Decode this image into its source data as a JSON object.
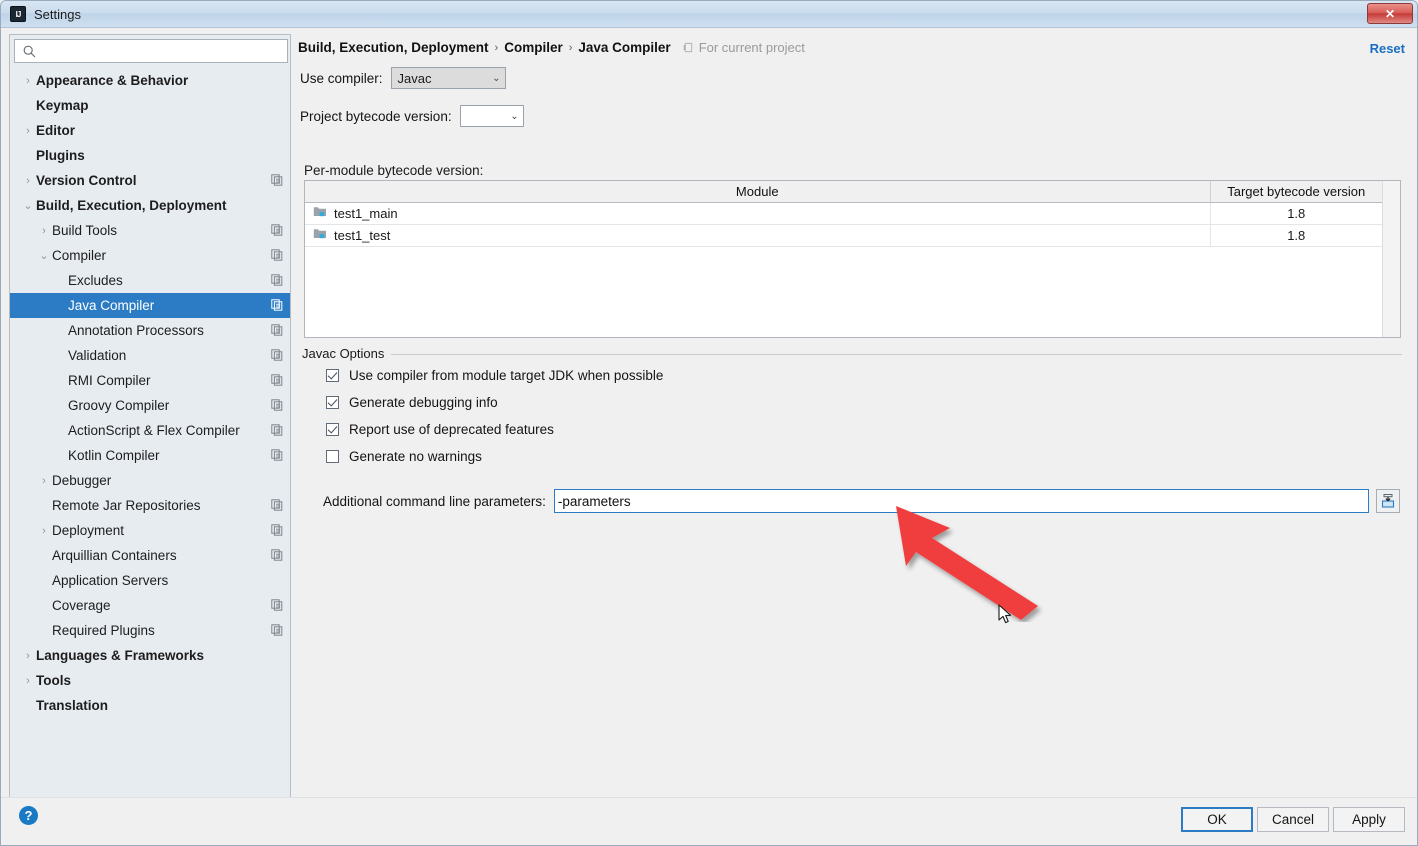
{
  "window": {
    "title": "Settings",
    "app_icon": "intellij-idea-icon",
    "close_label": "✕"
  },
  "sidebar": {
    "search": {
      "value": "",
      "placeholder": ""
    },
    "items": [
      {
        "label": "Appearance & Behavior",
        "indent": 0,
        "arrow": "right",
        "bold": true,
        "cfg": false,
        "selected": false
      },
      {
        "label": "Keymap",
        "indent": 0,
        "arrow": "none",
        "bold": true,
        "cfg": false,
        "selected": false
      },
      {
        "label": "Editor",
        "indent": 0,
        "arrow": "right",
        "bold": true,
        "cfg": false,
        "selected": false
      },
      {
        "label": "Plugins",
        "indent": 0,
        "arrow": "none",
        "bold": true,
        "cfg": false,
        "selected": false
      },
      {
        "label": "Version Control",
        "indent": 0,
        "arrow": "right",
        "bold": true,
        "cfg": true,
        "selected": false
      },
      {
        "label": "Build, Execution, Deployment",
        "indent": 0,
        "arrow": "down",
        "bold": true,
        "cfg": false,
        "selected": false
      },
      {
        "label": "Build Tools",
        "indent": 1,
        "arrow": "right",
        "bold": false,
        "cfg": true,
        "selected": false
      },
      {
        "label": "Compiler",
        "indent": 1,
        "arrow": "down",
        "bold": false,
        "cfg": true,
        "selected": false
      },
      {
        "label": "Excludes",
        "indent": 2,
        "arrow": "none",
        "bold": false,
        "cfg": true,
        "selected": false
      },
      {
        "label": "Java Compiler",
        "indent": 2,
        "arrow": "none",
        "bold": false,
        "cfg": true,
        "selected": true
      },
      {
        "label": "Annotation Processors",
        "indent": 2,
        "arrow": "none",
        "bold": false,
        "cfg": true,
        "selected": false
      },
      {
        "label": "Validation",
        "indent": 2,
        "arrow": "none",
        "bold": false,
        "cfg": true,
        "selected": false
      },
      {
        "label": "RMI Compiler",
        "indent": 2,
        "arrow": "none",
        "bold": false,
        "cfg": true,
        "selected": false
      },
      {
        "label": "Groovy Compiler",
        "indent": 2,
        "arrow": "none",
        "bold": false,
        "cfg": true,
        "selected": false
      },
      {
        "label": "ActionScript & Flex Compiler",
        "indent": 2,
        "arrow": "none",
        "bold": false,
        "cfg": true,
        "selected": false
      },
      {
        "label": "Kotlin Compiler",
        "indent": 2,
        "arrow": "none",
        "bold": false,
        "cfg": true,
        "selected": false
      },
      {
        "label": "Debugger",
        "indent": 1,
        "arrow": "right",
        "bold": false,
        "cfg": false,
        "selected": false
      },
      {
        "label": "Remote Jar Repositories",
        "indent": 1,
        "arrow": "none",
        "bold": false,
        "cfg": true,
        "selected": false
      },
      {
        "label": "Deployment",
        "indent": 1,
        "arrow": "right",
        "bold": false,
        "cfg": true,
        "selected": false
      },
      {
        "label": "Arquillian Containers",
        "indent": 1,
        "arrow": "none",
        "bold": false,
        "cfg": true,
        "selected": false
      },
      {
        "label": "Application Servers",
        "indent": 1,
        "arrow": "none",
        "bold": false,
        "cfg": false,
        "selected": false
      },
      {
        "label": "Coverage",
        "indent": 1,
        "arrow": "none",
        "bold": false,
        "cfg": true,
        "selected": false
      },
      {
        "label": "Required Plugins",
        "indent": 1,
        "arrow": "none",
        "bold": false,
        "cfg": true,
        "selected": false
      },
      {
        "label": "Languages & Frameworks",
        "indent": 0,
        "arrow": "right",
        "bold": true,
        "cfg": false,
        "selected": false
      },
      {
        "label": "Tools",
        "indent": 0,
        "arrow": "right",
        "bold": true,
        "cfg": false,
        "selected": false
      },
      {
        "label": "Translation",
        "indent": 0,
        "arrow": "none",
        "bold": true,
        "cfg": false,
        "selected": false
      }
    ]
  },
  "main": {
    "breadcrumb": [
      "Build, Execution, Deployment",
      "Compiler",
      "Java Compiler"
    ],
    "breadcrumb_separator": "›",
    "for_current_project": "For current project",
    "reset_label": "Reset",
    "use_compiler_label": "Use compiler:",
    "use_compiler_value": "Javac",
    "project_bytecode_label": "Project bytecode version:",
    "project_bytecode_value": "",
    "per_module_label": "Per-module bytecode version:",
    "table": {
      "columns": [
        "Module",
        "Target bytecode version"
      ],
      "rows": [
        {
          "module": "test1_main",
          "version": "1.8"
        },
        {
          "module": "test1_test",
          "version": "1.8"
        }
      ],
      "add_label": "+",
      "remove_label": "−"
    },
    "javac_options": {
      "group_title": "Javac Options",
      "checkboxes": [
        {
          "label": "Use compiler from module target JDK when possible",
          "checked": true
        },
        {
          "label": "Generate debugging info",
          "checked": true
        },
        {
          "label": "Report use of deprecated features",
          "checked": true
        },
        {
          "label": "Generate no warnings",
          "checked": false
        }
      ],
      "params_label": "Additional command line parameters:",
      "params_value": "-parameters",
      "expand_icon": "expand-editor-icon"
    }
  },
  "footer": {
    "help_label": "?",
    "buttons": [
      {
        "label": "OK",
        "primary": true
      },
      {
        "label": "Cancel",
        "primary": false
      },
      {
        "label": "Apply",
        "primary": false
      }
    ]
  },
  "annotation": {
    "arrow_color": "#f03c3c",
    "arrow_name": "red-pointer-arrow"
  },
  "colors": {
    "selection": "#2b7cc4",
    "link": "#1a6fc4",
    "add": "#3aaa4a",
    "titlebar": "#cadcee"
  }
}
